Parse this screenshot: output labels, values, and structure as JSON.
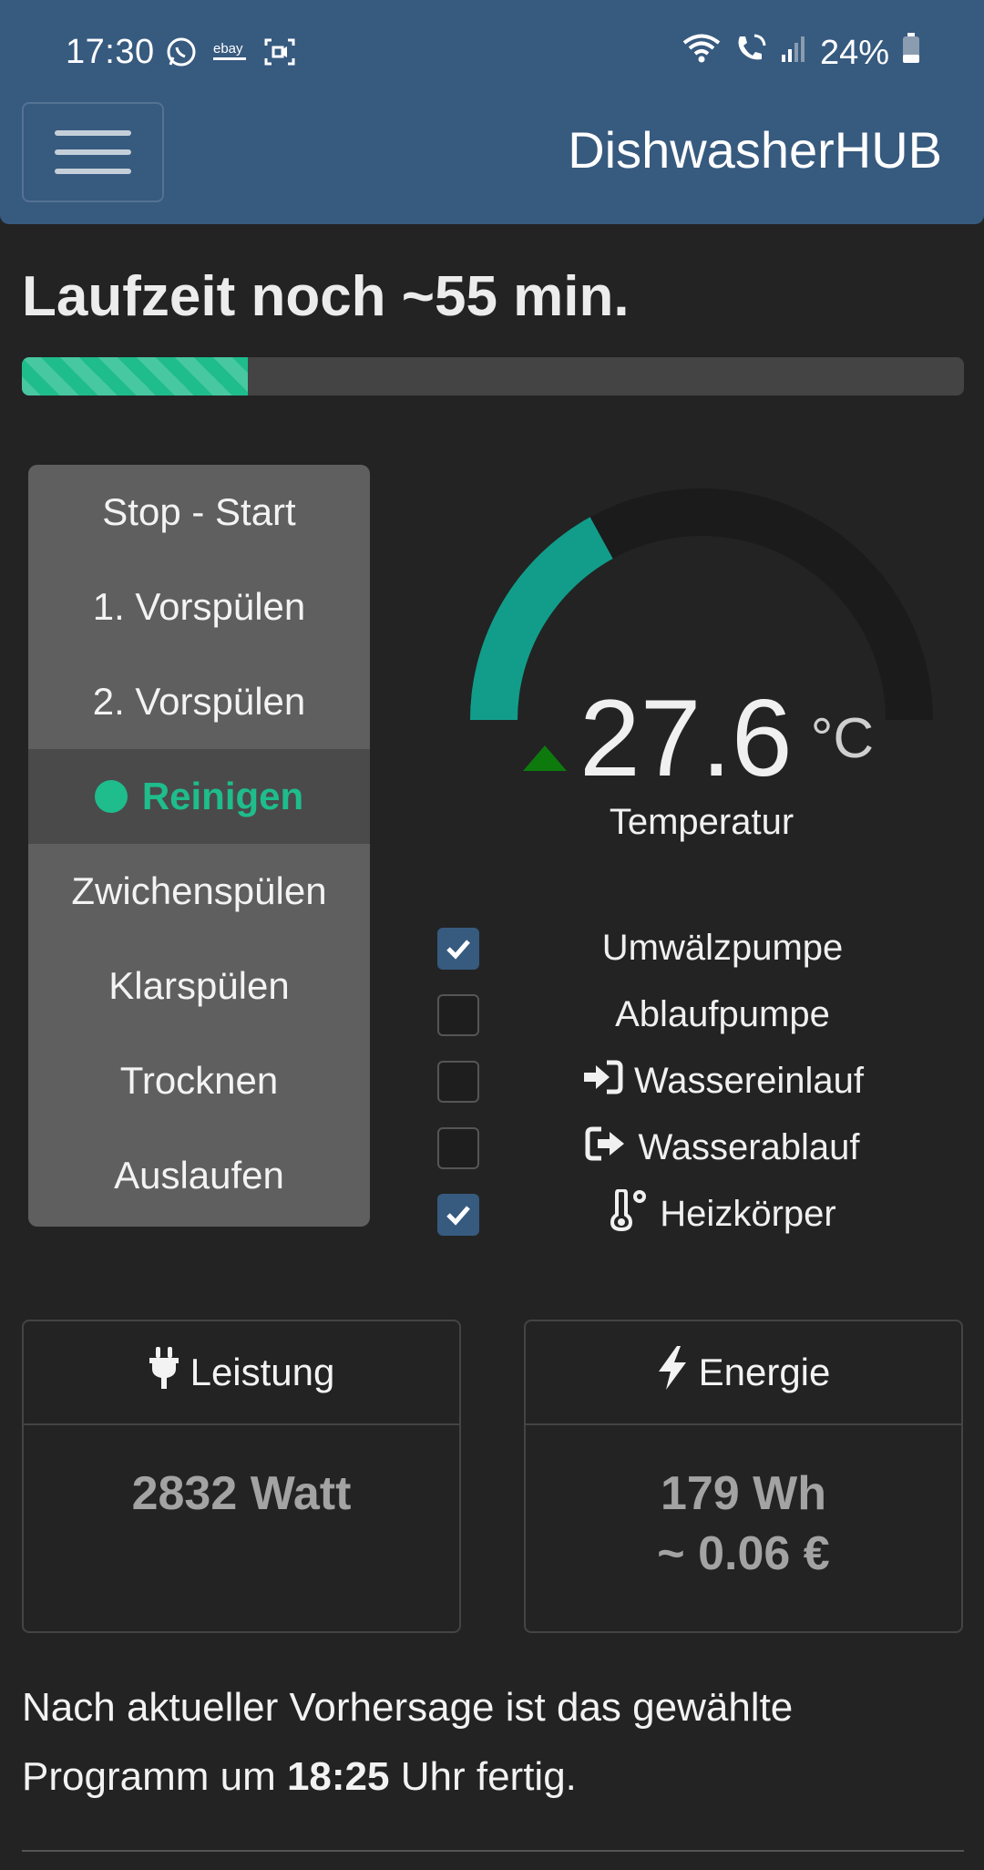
{
  "status_bar": {
    "time": "17:30",
    "battery": "24%",
    "app_icons": [
      "whatsapp-icon",
      "ebay-icon",
      "screen-record-icon"
    ],
    "system_icons": [
      "wifi-icon",
      "wifi-calling-icon",
      "signal-icon",
      "battery-icon"
    ]
  },
  "navbar": {
    "brand": "DishwasherHUB",
    "menu_icon": "hamburger-icon"
  },
  "runtime": {
    "title": "Laufzeit noch ~55 min.",
    "progress_fraction": 0.24
  },
  "phases": {
    "items": [
      {
        "label": "Stop - Start"
      },
      {
        "label": "1. Vorspülen"
      },
      {
        "label": "2. Vorspülen"
      },
      {
        "label": "Reinigen",
        "active": true
      },
      {
        "label": "Zwichenspülen"
      },
      {
        "label": "Klarspülen"
      },
      {
        "label": "Trocknen"
      },
      {
        "label": "Auslaufen"
      }
    ]
  },
  "gauge": {
    "value": "27.6",
    "unit": "°C",
    "label": "Temperatur",
    "fill_fraction": 0.34,
    "trend": "up",
    "colors": {
      "fill": "#129d8b",
      "track": "#1b1b1b",
      "trend": "#0e7a0e"
    }
  },
  "components": [
    {
      "label": "Umwälzpumpe",
      "checked": true,
      "icon": ""
    },
    {
      "label": "Ablaufpumpe",
      "checked": false,
      "icon": ""
    },
    {
      "label": "Wassereinlauf",
      "checked": false,
      "icon": "sign-in-icon"
    },
    {
      "label": "Wasserablauf",
      "checked": false,
      "icon": "sign-out-icon"
    },
    {
      "label": "Heizkörper",
      "checked": true,
      "icon": "thermometer-icon"
    }
  ],
  "cards": {
    "power": {
      "title": "Leistung",
      "value": "2832 Watt",
      "icon": "plug-icon"
    },
    "energy": {
      "title": "Energie",
      "value": "179 Wh",
      "cost": "~ 0.06 €",
      "icon": "lightning-icon"
    }
  },
  "forecast": {
    "text_before": "Nach aktueller Vorhersage ist das gewählte Programm um ",
    "time": "18:25",
    "text_after": " Uhr fertig."
  },
  "theme": {
    "navbar_bg": "#375a7f",
    "body_bg": "#232323",
    "accent": "#1fbc8c"
  }
}
